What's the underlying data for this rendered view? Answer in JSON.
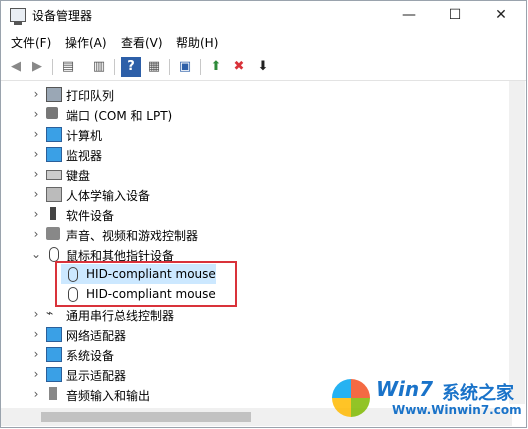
{
  "window": {
    "title": "设备管理器",
    "minimize": "—",
    "maximize": "☐",
    "close": "✕"
  },
  "menu": [
    "文件(F)",
    "操作(A)",
    "查看(V)",
    "帮助(H)"
  ],
  "toolbar": [
    "◀",
    "▶",
    "▤",
    "▥",
    "?",
    "▦",
    "▣",
    "⬆",
    "✖",
    "⬇"
  ],
  "tree": [
    {
      "label": "打印队列",
      "expanded": false,
      "icon": "printer-icon"
    },
    {
      "label": "端口 (COM 和 LPT)",
      "expanded": false,
      "icon": "port-icon"
    },
    {
      "label": "计算机",
      "expanded": false,
      "icon": "computer-icon"
    },
    {
      "label": "监视器",
      "expanded": false,
      "icon": "monitor-icon"
    },
    {
      "label": "键盘",
      "expanded": false,
      "icon": "keyboard-icon"
    },
    {
      "label": "人体学输入设备",
      "expanded": false,
      "icon": "hid-icon"
    },
    {
      "label": "软件设备",
      "expanded": false,
      "icon": "software-device-icon"
    },
    {
      "label": "声音、视频和游戏控制器",
      "expanded": false,
      "icon": "sound-icon"
    },
    {
      "label": "鼠标和其他指针设备",
      "expanded": true,
      "icon": "mouse-icon"
    },
    {
      "label": "HID-compliant mouse",
      "child": true,
      "icon": "mouse-icon"
    },
    {
      "label": "HID-compliant mouse",
      "child": true,
      "icon": "mouse-icon"
    },
    {
      "label": "通用串行总线控制器",
      "expanded": false,
      "icon": "usb-icon"
    },
    {
      "label": "网络适配器",
      "expanded": false,
      "icon": "network-icon"
    },
    {
      "label": "系统设备",
      "expanded": false,
      "icon": "system-device-icon"
    },
    {
      "label": "显示适配器",
      "expanded": false,
      "icon": "display-adapter-icon"
    },
    {
      "label": "音频输入和输出",
      "expanded": false,
      "icon": "audio-icon"
    }
  ],
  "watermark": {
    "brand": "Win7",
    "cn": "系统之家",
    "url": "Www.Winwin7.com"
  }
}
